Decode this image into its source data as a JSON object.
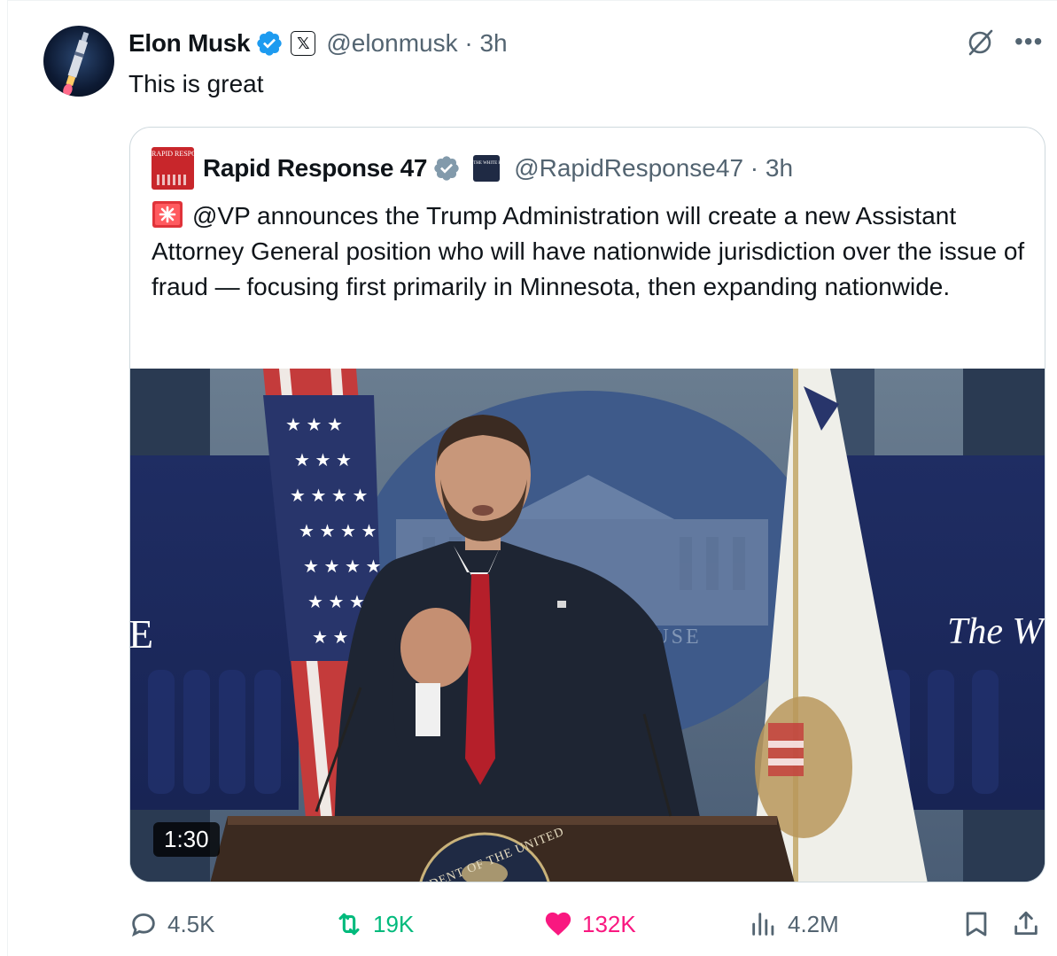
{
  "author": {
    "name": "Elon Musk",
    "handle": "@elonmusk",
    "time": "· 3h",
    "verified_icon": "verified-badge-icon",
    "affiliation_icon": "x-logo-icon",
    "affiliation_glyph": "𝕏"
  },
  "tweet": {
    "text": "This is great"
  },
  "quoted": {
    "logo_text": "RAPID RESPONSE",
    "name": "Rapid Response 47",
    "handle": "@RapidResponse47",
    "time": "· 3h",
    "affiliation_text": "THE WHITE HOUSE",
    "text": "@VP announces the Trump Administration will create a new Assistant Attorney General position who will have nationwide jurisdiction over the issue of fraud — focusing first primarily in Minnesota, then expanding nationwide.",
    "video": {
      "duration": "1:30",
      "backdrop_left": "E",
      "backdrop_right": "The W",
      "backdrop_center": "OUSE",
      "seal_text": "SIDENT OF THE UNITED"
    }
  },
  "actions": {
    "replies": "4.5K",
    "reposts": "19K",
    "likes": "132K",
    "views": "4.2M"
  },
  "colors": {
    "text": "#0f1419",
    "secondary": "#536471",
    "verified_blue": "#1d9bf0",
    "verified_gray": "#829aab",
    "repost_green": "#00ba7c",
    "like_pink": "#f91880",
    "border": "#cfd9de"
  }
}
